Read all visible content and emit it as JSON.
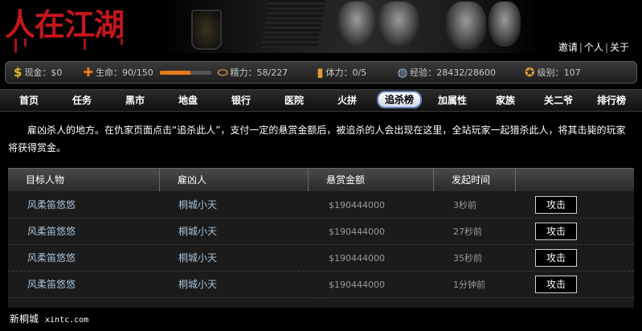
{
  "header": {
    "logo_text": "人在江湖",
    "links": [
      "邀请",
      "个人",
      "关于"
    ],
    "link_sep": "|"
  },
  "status": {
    "money": "现金：$0",
    "life": "生命：90/150",
    "life_fraction": 0.6,
    "energy": "精力：58/227",
    "stamina": "体力：0/5",
    "exp": "经验：28432/28600",
    "level": "级别：107"
  },
  "nav": [
    "首页",
    "任务",
    "黑市",
    "地盘",
    "银行",
    "医院",
    "火拼",
    "追杀榜",
    "加属性",
    "家族",
    "关二爷",
    "排行榜"
  ],
  "nav_active": "追杀榜",
  "intro": "雇凶杀人的地方。在仇家页面点击“追杀此人”，支付一定的悬赏金额后，被追杀的人会出现在这里，全站玩家一起猎杀此人，将其击毙的玩家将获得赏金。",
  "table": {
    "headers": [
      "目标人物",
      "雇凶人",
      "悬赏金额",
      "发起时间",
      ""
    ],
    "rows": [
      {
        "target": "风柔笛悠悠",
        "hirer": "桐城小天",
        "bounty": "$190444000",
        "time": "3秒前",
        "action": "攻击"
      },
      {
        "target": "风柔笛悠悠",
        "hirer": "桐城小天",
        "bounty": "$190444000",
        "time": "27秒前",
        "action": "攻击"
      },
      {
        "target": "风柔笛悠悠",
        "hirer": "桐城小天",
        "bounty": "$190444000",
        "time": "35秒前",
        "action": "攻击"
      },
      {
        "target": "风柔笛悠悠",
        "hirer": "桐城小天",
        "bounty": "$190444000",
        "time": "1分钟前",
        "action": "攻击"
      }
    ]
  },
  "footer": {
    "name": "新桐城",
    "site": "xintc.com"
  }
}
